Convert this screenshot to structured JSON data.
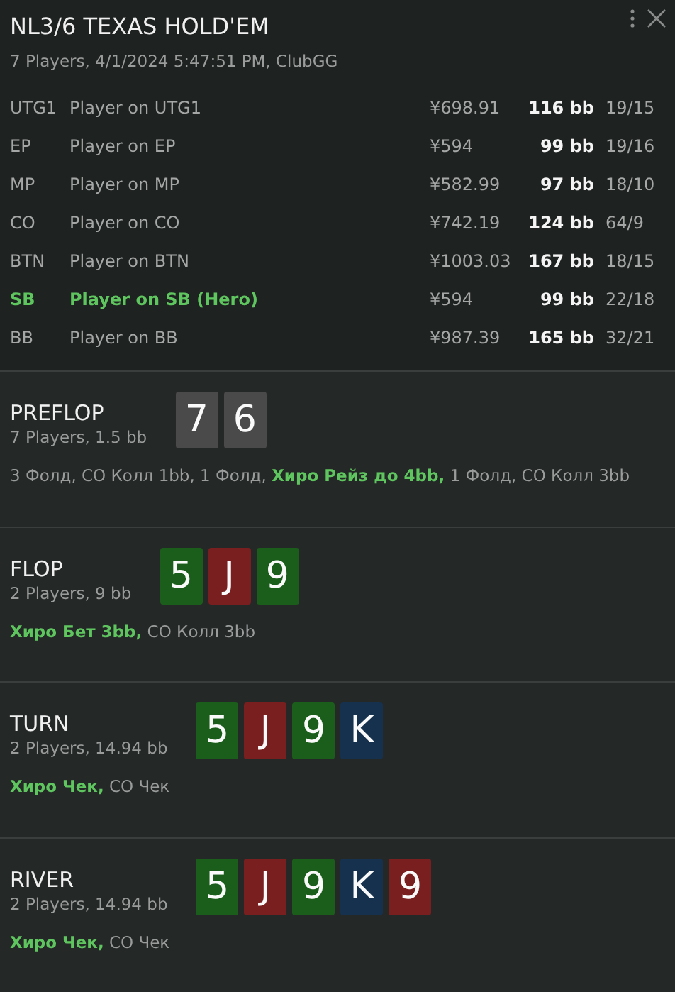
{
  "header": {
    "title": "NL3/6 TEXAS HOLD'EM",
    "subtitle": "7 Players, 4/1/2024 5:47:51 PM, ClubGG"
  },
  "players": [
    {
      "position": "UTG1",
      "name": "Player on UTG1",
      "stack": "¥698.91",
      "bb": "116 bb",
      "ratio": "19/15",
      "hero": false
    },
    {
      "position": "EP",
      "name": "Player on EP",
      "stack": "¥594",
      "bb": "99 bb",
      "ratio": "19/16",
      "hero": false
    },
    {
      "position": "MP",
      "name": "Player on MP",
      "stack": "¥582.99",
      "bb": "97 bb",
      "ratio": "18/10",
      "hero": false
    },
    {
      "position": "CO",
      "name": "Player on CO",
      "stack": "¥742.19",
      "bb": "124 bb",
      "ratio": "64/9",
      "hero": false
    },
    {
      "position": "BTN",
      "name": "Player on BTN",
      "stack": "¥1003.03",
      "bb": "167 bb",
      "ratio": "18/15",
      "hero": false
    },
    {
      "position": "SB",
      "name": "Player on SB (Hero)",
      "stack": "¥594",
      "bb": "99 bb",
      "ratio": "22/18",
      "hero": true
    },
    {
      "position": "BB",
      "name": "Player on BB",
      "stack": "¥987.39",
      "bb": "165 bb",
      "ratio": "32/21",
      "hero": false
    }
  ],
  "streets": [
    {
      "name": "PREFLOP",
      "info": "7 Players, 1.5 bb",
      "cards": [
        {
          "rank": "7",
          "color": "#4a4a4a"
        },
        {
          "rank": "6",
          "color": "#4a4a4a"
        }
      ],
      "actions": "3 Фолд, CO Колл 1bb, 1 Фолд, **Хиро Рейз до 4bb,** 1 Фолд, CO Колл 3bb"
    },
    {
      "name": "FLOP",
      "info": "2 Players, 9 bb",
      "cards": [
        {
          "rank": "5",
          "color": "#1b5e1b"
        },
        {
          "rank": "J",
          "color": "#7a1f1f"
        },
        {
          "rank": "9",
          "color": "#1b5e1b"
        }
      ],
      "actions": "**Хиро Бет 3bb,** CO Колл 3bb"
    },
    {
      "name": "TURN",
      "info": "2 Players, 14.94 bb",
      "cards": [
        {
          "rank": "5",
          "color": "#1b5e1b"
        },
        {
          "rank": "J",
          "color": "#7a1f1f"
        },
        {
          "rank": "9",
          "color": "#1b5e1b"
        },
        {
          "rank": "K",
          "color": "#15314d"
        }
      ],
      "actions": "**Хиро Чек,** CO Чек"
    },
    {
      "name": "RIVER",
      "info": "2 Players, 14.94 bb",
      "cards": [
        {
          "rank": "5",
          "color": "#1b5e1b"
        },
        {
          "rank": "J",
          "color": "#7a1f1f"
        },
        {
          "rank": "9",
          "color": "#1b5e1b"
        },
        {
          "rank": "K",
          "color": "#15314d"
        },
        {
          "rank": "9",
          "color": "#7a1f1f"
        }
      ],
      "actions": "**Хиро Чек,** CO Чек"
    }
  ]
}
